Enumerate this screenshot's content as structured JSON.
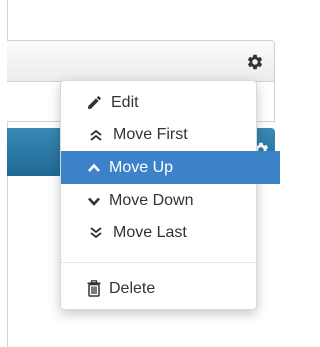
{
  "menu": {
    "items": [
      {
        "label": "Edit",
        "icon": "pencil-icon"
      },
      {
        "label": "Move First",
        "icon": "double-chevron-up-icon"
      },
      {
        "label": "Move Up",
        "icon": "chevron-up-icon",
        "active": true
      },
      {
        "label": "Move Down",
        "icon": "chevron-down-icon"
      },
      {
        "label": "Move Last",
        "icon": "double-chevron-down-icon"
      }
    ],
    "delete": {
      "label": "Delete",
      "icon": "trash-icon"
    }
  },
  "colors": {
    "accent": "#3c82c8",
    "panel_bar": "#2a7aa6",
    "text": "#333333"
  }
}
